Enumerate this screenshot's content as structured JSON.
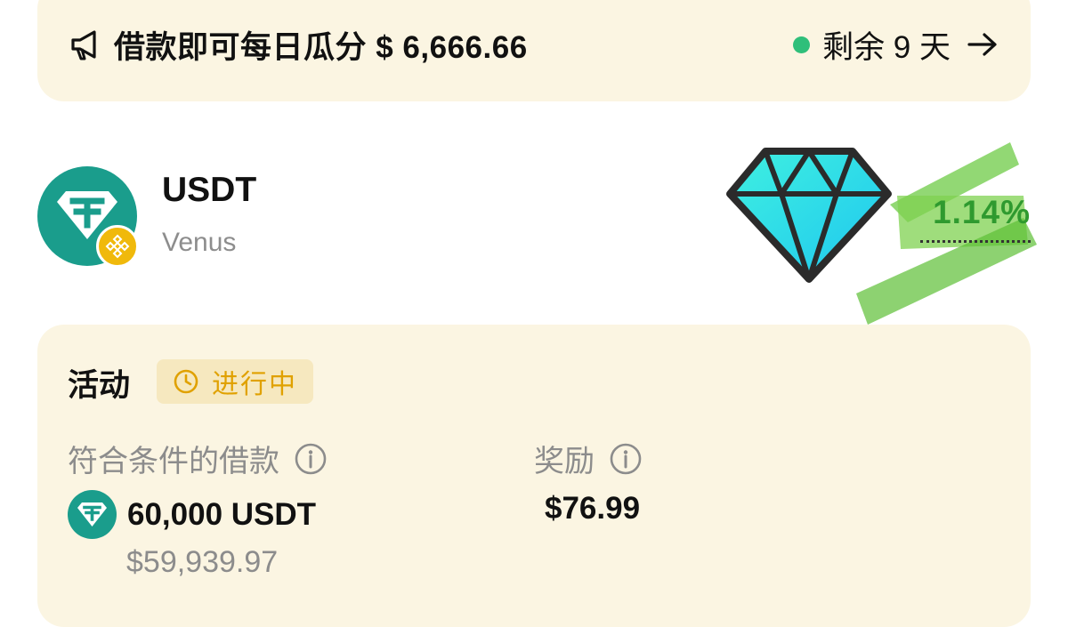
{
  "banner": {
    "icon": "megaphone-icon",
    "text": "借款即可每日瓜分 $ 6,666.66",
    "remaining": "剩余 9 天",
    "status_color": "#2fbf7a",
    "arrow_icon": "arrow-right-icon"
  },
  "token": {
    "symbol": "USDT",
    "platform": "Venus",
    "logo_icon": "tether-icon",
    "badge_icon": "bnb-icon",
    "apy": "1.14%",
    "decoration": "diamond-icon"
  },
  "activity": {
    "title": "活动",
    "status": "进行中",
    "status_icon": "clock-icon",
    "eligible_label": "符合条件的借款",
    "reward_label": "奖励",
    "borrow_amount": "60,000 USDT",
    "borrow_usd": "$59,939.97",
    "reward_value": "$76.99"
  },
  "colors": {
    "card_background": "#fbf5e2",
    "accent_green": "#2f9a2f",
    "status_yellow": "#e0a100",
    "tether_teal": "#1a9d8c"
  }
}
